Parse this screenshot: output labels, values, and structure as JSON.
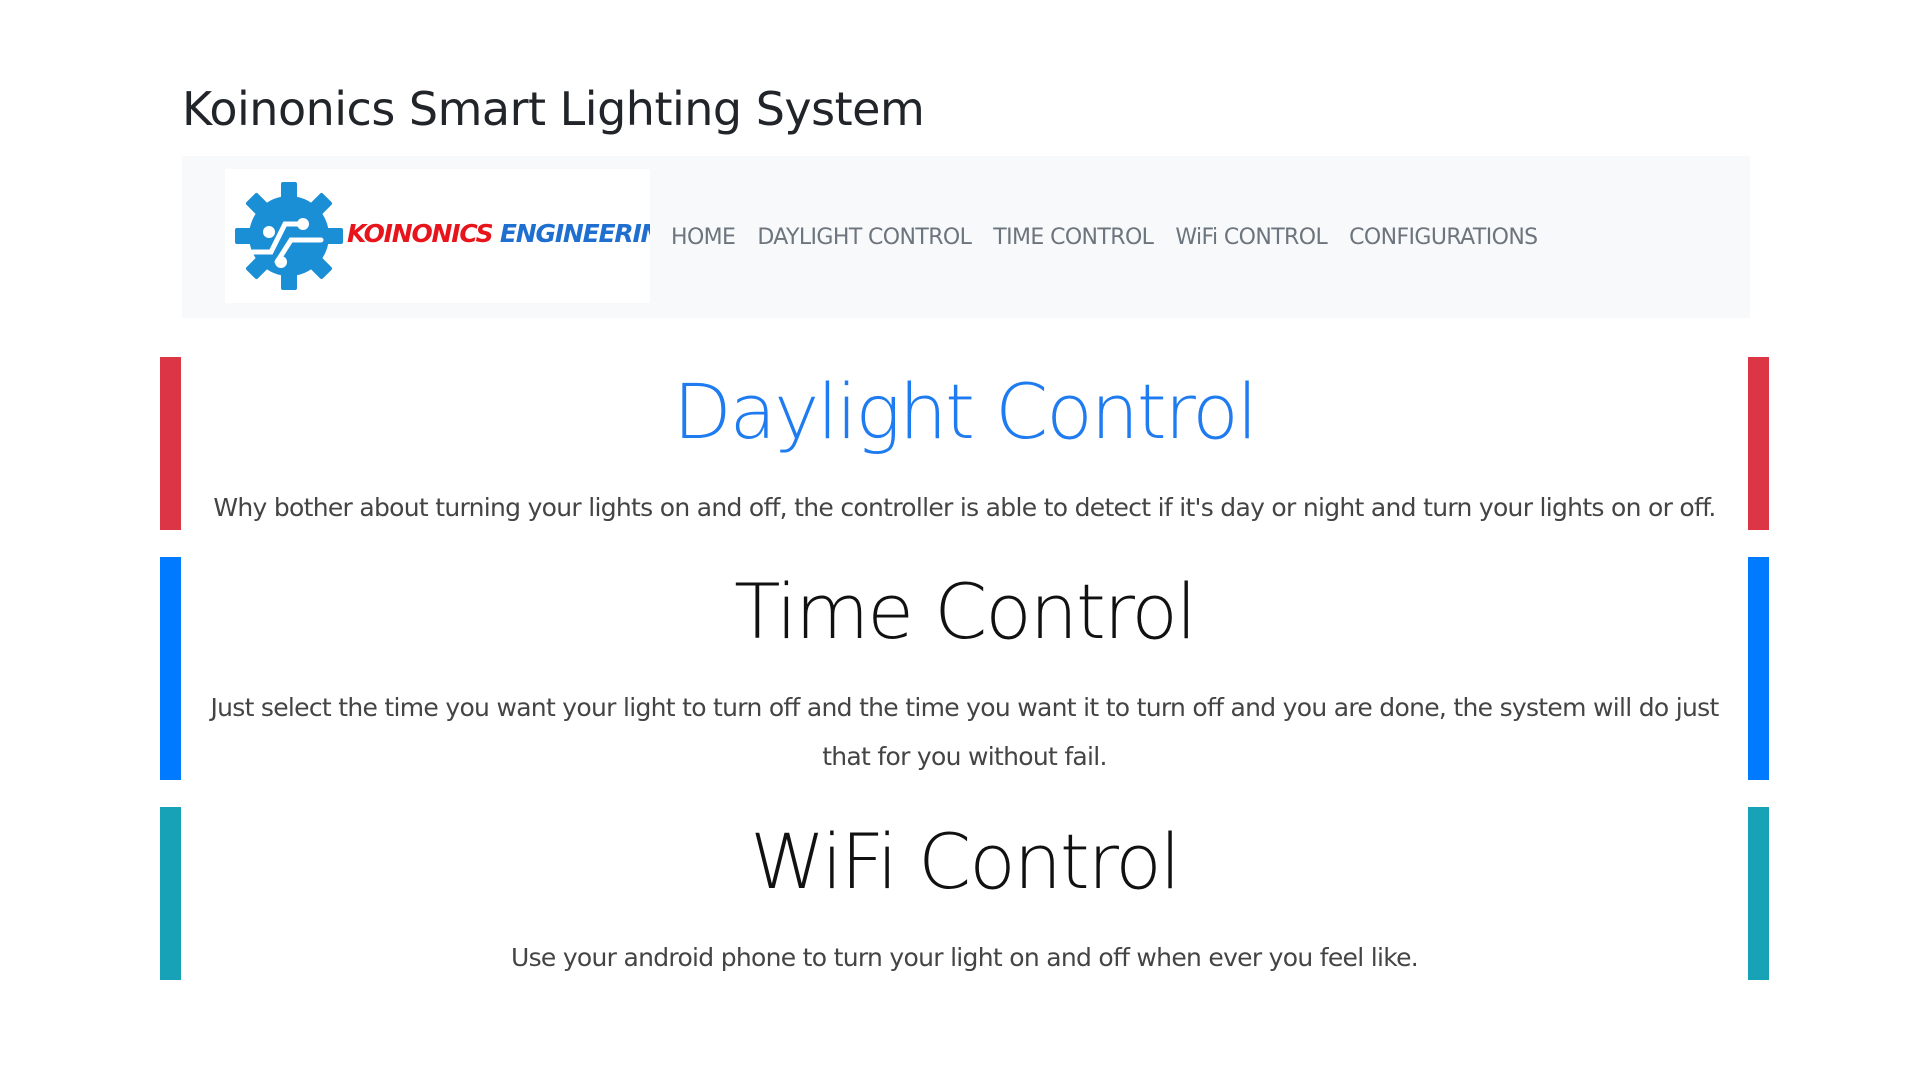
{
  "header": {
    "title": "Koinonics Smart Lighting System"
  },
  "brand": {
    "logo_icon": "gear-circuit-icon",
    "name_part1": "KOINONICS",
    "name_part2": "ENGINEERING",
    "colors": {
      "red": "#e8141c",
      "blue": "#1e6fd0",
      "gear": "#1a8fd6"
    }
  },
  "nav": {
    "items": [
      {
        "label": "HOME"
      },
      {
        "label": "DAYLIGHT CONTROL"
      },
      {
        "label": "TIME CONTROL"
      },
      {
        "label": "WiFi CONTROL"
      },
      {
        "label": "CONFIGURATIONS"
      }
    ]
  },
  "features": [
    {
      "title": "Daylight Control",
      "description": "Why bother about turning your lights on and off, the controller is able to detect if it's day or night and turn your lights on or off.",
      "accent_color": "#dc3545",
      "title_color": "#1e7bf0"
    },
    {
      "title": "Time Control",
      "description": "Just select the time you want your light to turn off and the time you want it to turn off and you are done, the system will do just that for you without fail.",
      "accent_color": "#007bff",
      "title_color": "#111111"
    },
    {
      "title": "WiFi Control",
      "description": "Use your android phone to turn your light on and off when ever you feel like.",
      "accent_color": "#17a2b8",
      "title_color": "#111111"
    }
  ]
}
